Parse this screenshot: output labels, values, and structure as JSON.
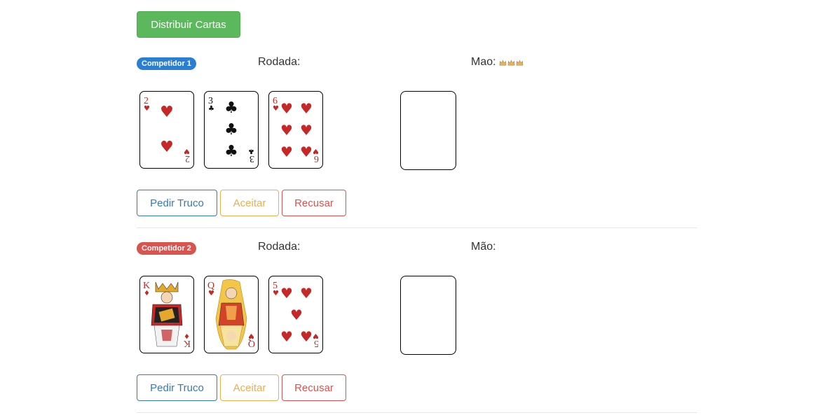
{
  "toolbar": {
    "deal_label": "Distribuir Cartas"
  },
  "colors": {
    "success": "#5cb85c",
    "primary": "#337ab7",
    "warning": "#f0ad4e",
    "danger": "#d9534f",
    "badge_blue": "#2a7ed3"
  },
  "players": [
    {
      "badge": "Competidor 1",
      "round_label": "Rodada:",
      "hand_label": "Mao:",
      "hand_icons": [
        "crown-icon",
        "crown-icon",
        "crown-icon"
      ],
      "cards": [
        {
          "rank": "2",
          "suit": "hearts"
        },
        {
          "rank": "3",
          "suit": "clubs"
        },
        {
          "rank": "6",
          "suit": "hearts"
        }
      ],
      "actions": {
        "truco": "Pedir Truco",
        "accept": "Aceitar",
        "refuse": "Recusar"
      }
    },
    {
      "badge": "Competidor 2",
      "round_label": "Rodada:",
      "hand_label": "Mão:",
      "cards": [
        {
          "rank": "K",
          "suit": "diamonds"
        },
        {
          "rank": "Q",
          "suit": "hearts"
        },
        {
          "rank": "5",
          "suit": "hearts"
        }
      ],
      "actions": {
        "truco": "Pedir Truco",
        "accept": "Aceitar",
        "refuse": "Recusar"
      }
    }
  ]
}
